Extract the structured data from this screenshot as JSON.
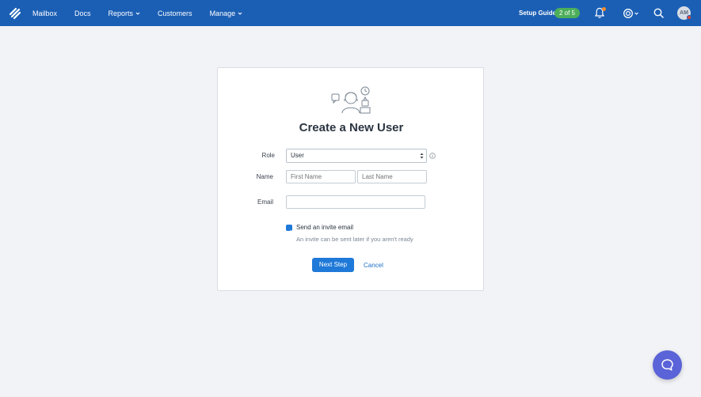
{
  "nav": {
    "items": [
      {
        "label": "Mailbox",
        "dropdown": false
      },
      {
        "label": "Docs",
        "dropdown": false
      },
      {
        "label": "Reports",
        "dropdown": true
      },
      {
        "label": "Customers",
        "dropdown": false
      },
      {
        "label": "Manage",
        "dropdown": true
      }
    ],
    "setup_label": "Setup Guide",
    "setup_progress": "2 of 5",
    "avatar_initials": "AM"
  },
  "form": {
    "title": "Create a New User",
    "role_label": "Role",
    "role_value": "User",
    "name_label": "Name",
    "first_name_placeholder": "First Name",
    "last_name_placeholder": "Last Name",
    "email_label": "Email",
    "email_value": "",
    "invite_checked": true,
    "invite_label": "Send an invite email",
    "invite_help": "An invite can be sent later if you aren't ready",
    "next_label": "Next Step",
    "cancel_label": "Cancel"
  },
  "icons": [
    "logo-icon",
    "chevron-down-icon",
    "bell-icon",
    "help-icon",
    "search-icon",
    "info-icon",
    "user-illustration",
    "chat-icon"
  ],
  "colors": {
    "topbar": "#1b5fb5",
    "primary": "#1f79d8",
    "badge": "#4cae5a",
    "chat": "#5b63d8"
  }
}
